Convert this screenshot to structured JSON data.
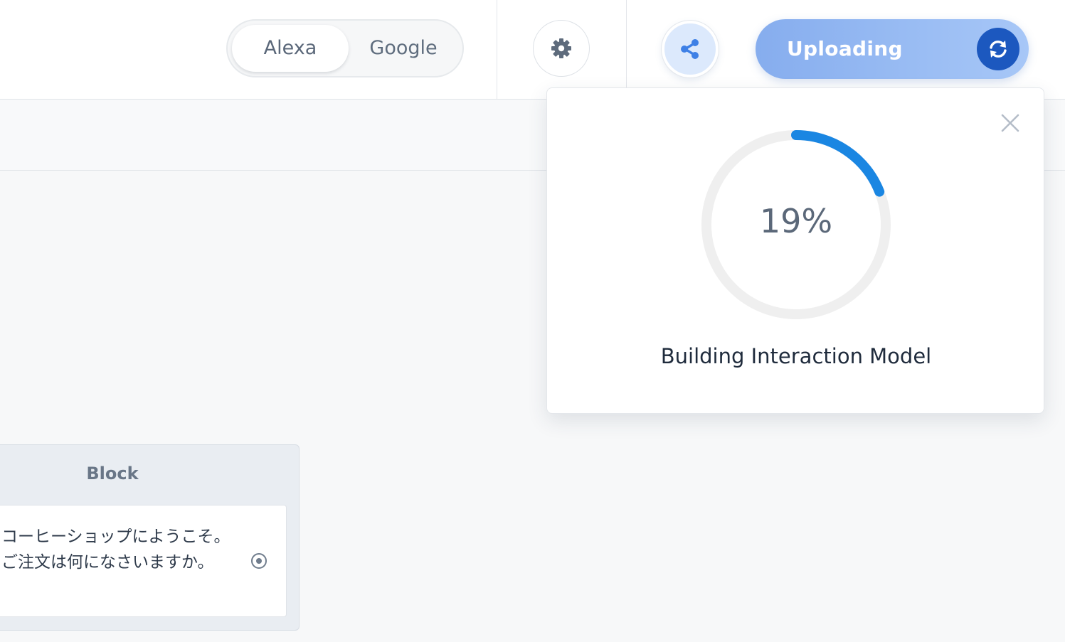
{
  "toolbar": {
    "platform_options": [
      "Alexa",
      "Google"
    ],
    "selected_platform": "Alexa",
    "settings_icon": "gear-icon",
    "share_icon": "share-icon",
    "upload_label": "Uploading",
    "upload_icon": "sync-icon"
  },
  "progress_popover": {
    "percent_value": 19,
    "percent_text": "19%",
    "caption": "Building Interaction Model",
    "close_icon": "close-icon"
  },
  "block": {
    "title": "Block",
    "text": "コーヒーショップにようこそ。ご注文は何になさいますか。",
    "radio_icon": "radio-target-icon"
  },
  "colors": {
    "progress_arc": "#1a86e2",
    "progress_track": "#efefef",
    "upload_button": "#8fb3f0",
    "sync_circle": "#1c58bf",
    "share_button_bg": "#dce9fc",
    "share_icon": "#3e80e6"
  }
}
